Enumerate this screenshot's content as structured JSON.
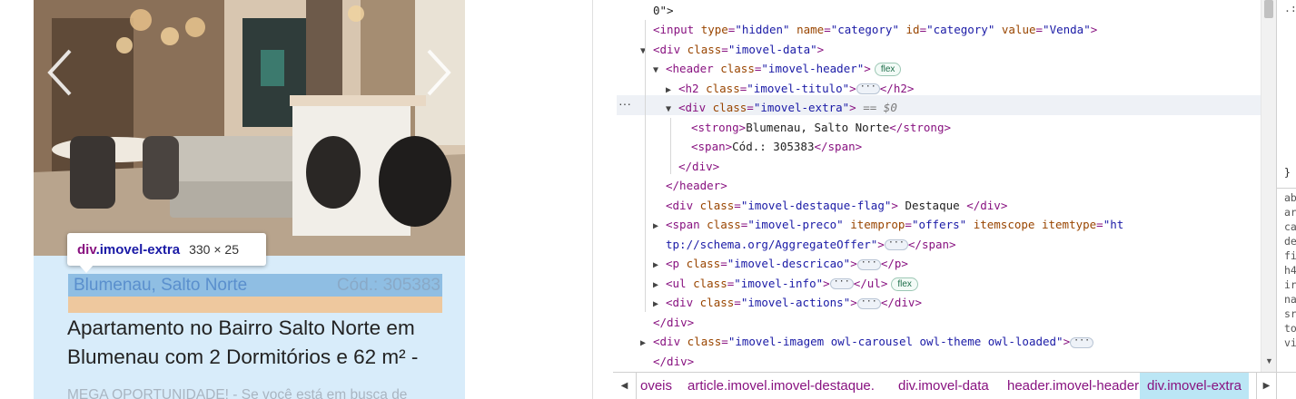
{
  "page_preview": {
    "carousel": {
      "prev_icon": "chevron-left-icon",
      "next_icon": "chevron-right-icon"
    },
    "imovel_extra": {
      "location": "Blumenau, Salto Norte",
      "code": "Cód.: 305383"
    },
    "titulo": "Apartamento no Bairro Salto Norte em Blumenau com 2 Dormitórios e 62 m² -",
    "descricao": "MEGA OPORTUNIDADE! - Se você está em busca de",
    "inspect_tooltip": {
      "tag": "div",
      "class": ".imovel-extra",
      "dimensions": "330 × 25"
    },
    "colors": {
      "highlight_content": "#8fbee3",
      "highlight_margin": "#eec89e",
      "card_background": "#d8ecfa"
    }
  },
  "devtools": {
    "gutter_dots": "···",
    "lines": [
      {
        "indent": 0,
        "arrow": "",
        "parts": [
          {
            "t": "txt",
            "v": "0\">"
          }
        ]
      },
      {
        "indent": 0,
        "arrow": "",
        "parts": [
          {
            "t": "tag",
            "v": "<input "
          },
          {
            "t": "an",
            "v": "type"
          },
          {
            "t": "tag",
            "v": "="
          },
          {
            "t": "av",
            "v": "\"hidden\""
          },
          {
            "t": "an",
            "v": " name"
          },
          {
            "t": "tag",
            "v": "="
          },
          {
            "t": "av",
            "v": "\"category\""
          },
          {
            "t": "an",
            "v": " id"
          },
          {
            "t": "tag",
            "v": "="
          },
          {
            "t": "av",
            "v": "\"category\""
          },
          {
            "t": "an",
            "v": " value"
          },
          {
            "t": "tag",
            "v": "="
          },
          {
            "t": "av",
            "v": "\"Venda\""
          },
          {
            "t": "tag",
            "v": ">"
          }
        ]
      },
      {
        "indent": 0,
        "arrow": "▼",
        "parts": [
          {
            "t": "tag",
            "v": "<div "
          },
          {
            "t": "an",
            "v": "class"
          },
          {
            "t": "tag",
            "v": "="
          },
          {
            "t": "av",
            "v": "\"imovel-data\""
          },
          {
            "t": "tag",
            "v": ">"
          }
        ]
      },
      {
        "indent": 1,
        "arrow": "▼",
        "parts": [
          {
            "t": "tag",
            "v": "<header "
          },
          {
            "t": "an",
            "v": "class"
          },
          {
            "t": "tag",
            "v": "="
          },
          {
            "t": "av",
            "v": "\"imovel-header\""
          },
          {
            "t": "tag",
            "v": ">"
          },
          {
            "t": "badge",
            "v": "flex"
          }
        ]
      },
      {
        "indent": 2,
        "arrow": "▶",
        "parts": [
          {
            "t": "tag",
            "v": "<h2 "
          },
          {
            "t": "an",
            "v": "class"
          },
          {
            "t": "tag",
            "v": "="
          },
          {
            "t": "av",
            "v": "\"imovel-titulo\""
          },
          {
            "t": "tag",
            "v": ">"
          },
          {
            "t": "dots",
            "v": "···"
          },
          {
            "t": "tag",
            "v": "</h2>"
          }
        ]
      },
      {
        "indent": 2,
        "arrow": "▼",
        "selected": true,
        "parts": [
          {
            "t": "tag",
            "v": "<div "
          },
          {
            "t": "an",
            "v": "class"
          },
          {
            "t": "tag",
            "v": "="
          },
          {
            "t": "av",
            "v": "\"imovel-extra\""
          },
          {
            "t": "tag",
            "v": ">"
          },
          {
            "t": "eq",
            "v": " == $0"
          }
        ]
      },
      {
        "indent": 3,
        "arrow": "",
        "parts": [
          {
            "t": "tag",
            "v": "<strong>"
          },
          {
            "t": "txt",
            "v": "Blumenau, Salto Norte"
          },
          {
            "t": "tag",
            "v": "</strong>"
          }
        ]
      },
      {
        "indent": 3,
        "arrow": "",
        "parts": [
          {
            "t": "tag",
            "v": "<span>"
          },
          {
            "t": "txt",
            "v": "Cód.: 305383"
          },
          {
            "t": "tag",
            "v": "</span>"
          }
        ]
      },
      {
        "indent": 2,
        "arrow": "",
        "parts": [
          {
            "t": "tag",
            "v": "</div>"
          }
        ]
      },
      {
        "indent": 1,
        "arrow": "",
        "parts": [
          {
            "t": "tag",
            "v": "</header>"
          }
        ]
      },
      {
        "indent": 1,
        "arrow": "",
        "parts": [
          {
            "t": "tag",
            "v": "<div "
          },
          {
            "t": "an",
            "v": "class"
          },
          {
            "t": "tag",
            "v": "="
          },
          {
            "t": "av",
            "v": "\"imovel-destaque-flag\""
          },
          {
            "t": "tag",
            "v": ">"
          },
          {
            "t": "txt",
            "v": " Destaque "
          },
          {
            "t": "tag",
            "v": "</div>"
          }
        ]
      },
      {
        "indent": 1,
        "arrow": "▶",
        "parts": [
          {
            "t": "tag",
            "v": "<span "
          },
          {
            "t": "an",
            "v": "class"
          },
          {
            "t": "tag",
            "v": "="
          },
          {
            "t": "av",
            "v": "\"imovel-preco\""
          },
          {
            "t": "an",
            "v": " itemprop"
          },
          {
            "t": "tag",
            "v": "="
          },
          {
            "t": "av",
            "v": "\"offers\""
          },
          {
            "t": "an",
            "v": " itemscope"
          },
          {
            "t": "an",
            "v": " itemtype"
          },
          {
            "t": "tag",
            "v": "="
          },
          {
            "t": "av",
            "v": "\"ht"
          }
        ]
      },
      {
        "indent": 1,
        "arrow": "",
        "parts": [
          {
            "t": "av",
            "v": "tp://schema.org/AggregateOffer\""
          },
          {
            "t": "tag",
            "v": ">"
          },
          {
            "t": "dots",
            "v": "···"
          },
          {
            "t": "tag",
            "v": "</span>"
          }
        ]
      },
      {
        "indent": 1,
        "arrow": "▶",
        "parts": [
          {
            "t": "tag",
            "v": "<p "
          },
          {
            "t": "an",
            "v": "class"
          },
          {
            "t": "tag",
            "v": "="
          },
          {
            "t": "av",
            "v": "\"imovel-descricao\""
          },
          {
            "t": "tag",
            "v": ">"
          },
          {
            "t": "dots",
            "v": "···"
          },
          {
            "t": "tag",
            "v": "</p>"
          }
        ]
      },
      {
        "indent": 1,
        "arrow": "▶",
        "parts": [
          {
            "t": "tag",
            "v": "<ul "
          },
          {
            "t": "an",
            "v": "class"
          },
          {
            "t": "tag",
            "v": "="
          },
          {
            "t": "av",
            "v": "\"imovel-info\""
          },
          {
            "t": "tag",
            "v": ">"
          },
          {
            "t": "dots",
            "v": "···"
          },
          {
            "t": "tag",
            "v": "</ul>"
          },
          {
            "t": "badge",
            "v": "flex"
          }
        ]
      },
      {
        "indent": 1,
        "arrow": "▶",
        "parts": [
          {
            "t": "tag",
            "v": "<div "
          },
          {
            "t": "an",
            "v": "class"
          },
          {
            "t": "tag",
            "v": "="
          },
          {
            "t": "av",
            "v": "\"imovel-actions\""
          },
          {
            "t": "tag",
            "v": ">"
          },
          {
            "t": "dots",
            "v": "···"
          },
          {
            "t": "tag",
            "v": "</div>"
          }
        ]
      },
      {
        "indent": 0,
        "arrow": "",
        "parts": [
          {
            "t": "tag",
            "v": "</div>"
          }
        ]
      },
      {
        "indent": 0,
        "arrow": "▶",
        "parts": [
          {
            "t": "tag",
            "v": "<div "
          },
          {
            "t": "an",
            "v": "class"
          },
          {
            "t": "tag",
            "v": "="
          },
          {
            "t": "av",
            "v": "\"imovel-imagem owl-carousel owl-theme owl-loaded\""
          },
          {
            "t": "tag",
            "v": ">"
          },
          {
            "t": "dots",
            "v": "···"
          }
        ]
      },
      {
        "indent": 0,
        "arrow": "",
        "parts": [
          {
            "t": "tag",
            "v": "</div>"
          }
        ]
      }
    ],
    "breadcrumbs": [
      "oveis",
      "article.imovel.imovel-destaque.",
      "div.imovel-data",
      "header.imovel-header",
      "div.imovel-extra"
    ],
    "breadcrumb_active": "div.imovel-extra",
    "styles_fragments": [
      ".:",
      "}",
      "ab",
      "ar",
      "ca",
      "de",
      "fi",
      "h4",
      "ir",
      "na",
      "sr",
      "to",
      "vi"
    ]
  }
}
